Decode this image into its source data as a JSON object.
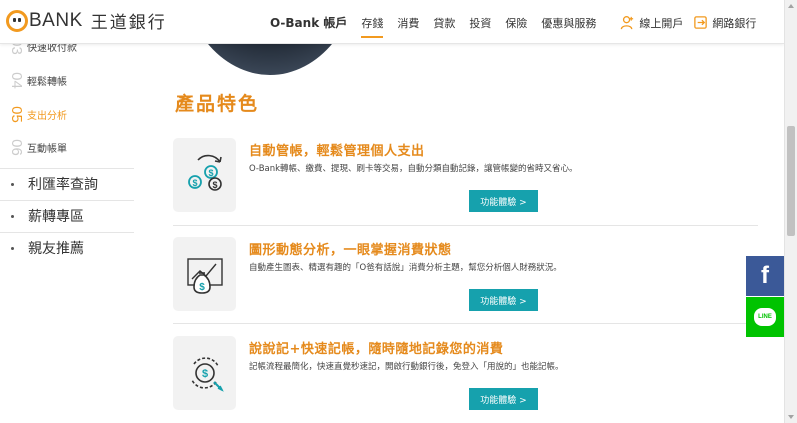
{
  "brand": {
    "logo_text": "BANK",
    "name_cn": "王道銀行"
  },
  "nav": {
    "items": [
      {
        "label": "O-Bank 帳戶"
      },
      {
        "label": "存錢"
      },
      {
        "label": "消費"
      },
      {
        "label": "貸款"
      },
      {
        "label": "投資"
      },
      {
        "label": "保險"
      },
      {
        "label": "優惠與服務"
      }
    ],
    "open_account": "線上開戶",
    "online_banking": "網路銀行"
  },
  "sidebar": {
    "sub_items": [
      {
        "num": "03",
        "label": "快速收付款"
      },
      {
        "num": "04",
        "label": "輕鬆轉帳"
      },
      {
        "num": "05",
        "label": "支出分析"
      },
      {
        "num": "06",
        "label": "互動帳單"
      }
    ],
    "main_items": [
      {
        "label": "利匯率查詢"
      },
      {
        "label": "薪轉專區"
      },
      {
        "label": "親友推薦"
      }
    ]
  },
  "section": {
    "title": "產品特色"
  },
  "features": [
    {
      "icon": "coins-refresh-icon",
      "title": "自動管帳，輕鬆管理個人支出",
      "desc": "O-Bank轉帳、繳費、提現、刷卡等交易，自動分類自動記錄，讓管帳變的省時又省心。",
      "button": "功能體驗 >"
    },
    {
      "icon": "money-bag-chart-icon",
      "title": "圖形動態分析，一眼掌握消費狀態",
      "desc": "自動產生圖表、精選有趣的「O爸有話說」消費分析主題，幫您分析個人財務狀況。",
      "button": "功能體驗 >"
    },
    {
      "icon": "coin-cycle-icon",
      "title": "說說記+快速記帳，隨時隨地記錄您的消費",
      "desc": "記帳流程最簡化，快速直覺秒速記，開啟行動銀行後，免登入「用說的」也能記帳。",
      "button": "功能體驗 >"
    }
  ],
  "social": {
    "facebook": "f",
    "line": "LINE"
  },
  "colors": {
    "accent": "#e58a1c",
    "teal": "#16a1ad",
    "facebook": "#3b5998",
    "line": "#00c300"
  }
}
